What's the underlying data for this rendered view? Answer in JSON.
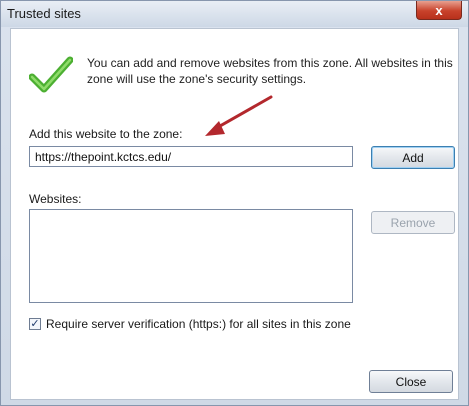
{
  "window": {
    "title": "Trusted sites",
    "close_glyph": "x"
  },
  "info": {
    "icon": "green-checkmark-icon",
    "text": "You can add and remove websites from this zone. All websites in this zone will use the zone's security settings."
  },
  "add_site": {
    "label": "Add this website to the zone:",
    "value": "https://thepoint.kctcs.edu/",
    "button": "Add"
  },
  "websites": {
    "label": "Websites:",
    "items": [],
    "remove_button": "Remove"
  },
  "require_verification": {
    "checked": true,
    "label": "Require server verification (https:) for all sites in this zone"
  },
  "footer": {
    "close_button": "Close"
  },
  "colors": {
    "accent_arrow": "#b3282d",
    "check_green": "#4caf32"
  }
}
